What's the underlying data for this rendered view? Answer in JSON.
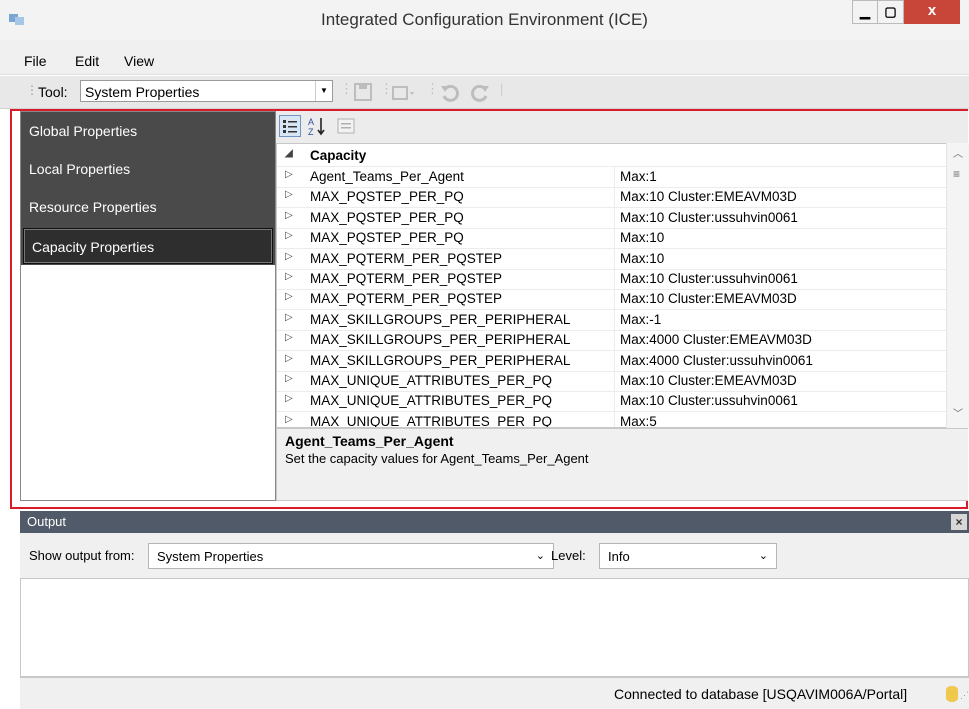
{
  "window": {
    "title": "Integrated Configuration Environment (ICE)",
    "min_label": "▁",
    "max_label": "☐",
    "close_label": "x"
  },
  "menu": [
    {
      "label": "File"
    },
    {
      "label": "Edit"
    },
    {
      "label": "View"
    }
  ],
  "toolbar": {
    "tool_label": "Tool:",
    "tool_value": "System Properties"
  },
  "sidebar": {
    "items": [
      {
        "label": "Global Properties"
      },
      {
        "label": "Local Properties"
      },
      {
        "label": "Resource Properties"
      },
      {
        "label": "Capacity Properties"
      }
    ],
    "active": "Capacity Properties"
  },
  "grid": {
    "category": "Capacity",
    "rows": [
      {
        "name": "Agent_Teams_Per_Agent",
        "value": "Max:1"
      },
      {
        "name": "MAX_PQSTEP_PER_PQ",
        "value": "Max:10 Cluster:EMEAVM03D"
      },
      {
        "name": "MAX_PQSTEP_PER_PQ",
        "value": "Max:10 Cluster:ussuhvin0061"
      },
      {
        "name": "MAX_PQSTEP_PER_PQ",
        "value": "Max:10"
      },
      {
        "name": "MAX_PQTERM_PER_PQSTEP",
        "value": "Max:10"
      },
      {
        "name": "MAX_PQTERM_PER_PQSTEP",
        "value": "Max:10 Cluster:ussuhvin0061"
      },
      {
        "name": "MAX_PQTERM_PER_PQSTEP",
        "value": "Max:10 Cluster:EMEAVM03D"
      },
      {
        "name": "MAX_SKILLGROUPS_PER_PERIPHERAL",
        "value": "Max:-1"
      },
      {
        "name": "MAX_SKILLGROUPS_PER_PERIPHERAL",
        "value": "Max:4000 Cluster:EMEAVM03D"
      },
      {
        "name": "MAX_SKILLGROUPS_PER_PERIPHERAL",
        "value": "Max:4000 Cluster:ussuhvin0061"
      },
      {
        "name": "MAX_UNIQUE_ATTRIBUTES_PER_PQ",
        "value": "Max:10 Cluster:EMEAVM03D"
      },
      {
        "name": "MAX_UNIQUE_ATTRIBUTES_PER_PQ",
        "value": "Max:10 Cluster:ussuhvin0061"
      },
      {
        "name": "MAX_UNIQUE_ATTRIBUTES_PER_PQ",
        "value": "Max:5"
      }
    ]
  },
  "description": {
    "title": "Agent_Teams_Per_Agent",
    "text": "Set the capacity values for Agent_Teams_Per_Agent"
  },
  "output": {
    "title": "Output",
    "close_label": "×",
    "show_from_label": "Show output from:",
    "show_from_value": "System Properties",
    "level_label": "Level:",
    "level_value": "Info"
  },
  "status": {
    "text": "Connected to database [USQAVIM006A/Portal]"
  },
  "icons": {
    "app": "app-icon",
    "save": "save-icon",
    "export": "export-icon",
    "undo": "undo-icon",
    "redo": "redo-icon",
    "categorized": "categorized-icon",
    "alphabetical": "sort-az-icon",
    "property-pages": "property-pages-icon",
    "database": "database-icon"
  },
  "colors": {
    "accent_frame": "#d81d2a",
    "sidebar_bg": "#4a4a4a",
    "output_header": "#515a69",
    "close_button": "#c8453a"
  }
}
